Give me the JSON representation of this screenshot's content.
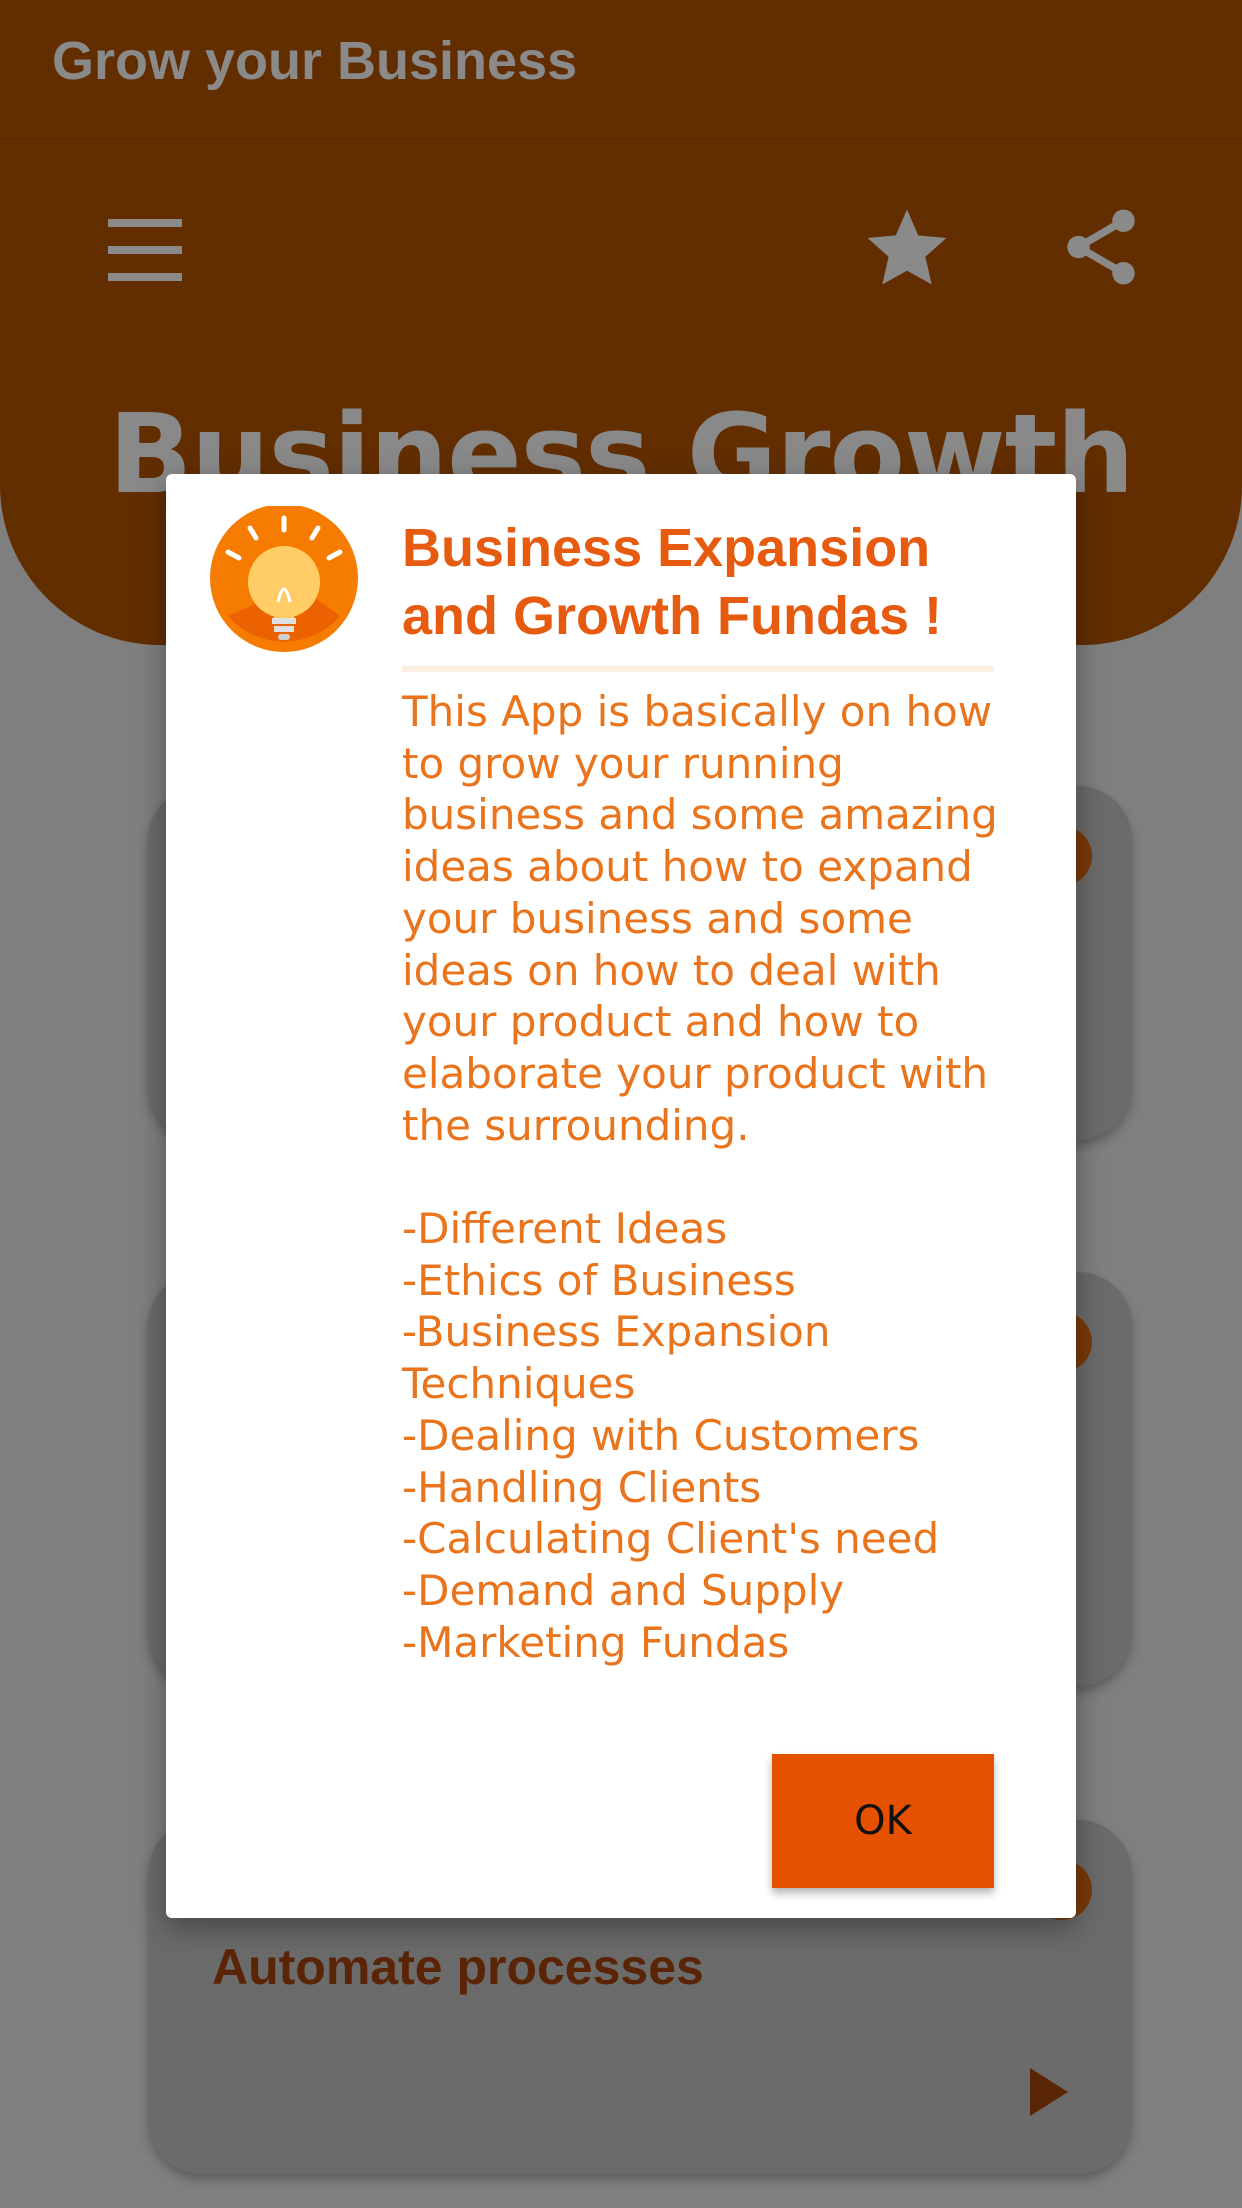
{
  "app": {
    "title": "Grow your Business"
  },
  "toolbar": {
    "menu_icon": "hamburger-menu-icon",
    "star_icon": "star-icon",
    "share_icon": "share-icon"
  },
  "header": {
    "banner_title": "Business Growth"
  },
  "cards": [
    {
      "title": ""
    },
    {
      "title": ""
    },
    {
      "title": "Automate processes"
    }
  ],
  "dialog": {
    "icon": "lightbulb-icon",
    "title": "Business Expansion and Growth Fundas !",
    "message": "This App is basically on how to grow your running business and some amazing ideas about how to expand your business and some ideas on how to deal with your product and how to elaborate your product with the surrounding.\n\n-Different Ideas\n-Ethics of Business\n-Business Expansion Techniques\n-Dealing with Customers\n-Handling Clients\n-Calculating Client's need\n-Demand and Supply\n-Marketing Fundas",
    "ok_label": "OK"
  },
  "colors": {
    "accent": "#e65100",
    "header_dimmed": "#622e00",
    "dialog_text": "#e9741c"
  }
}
